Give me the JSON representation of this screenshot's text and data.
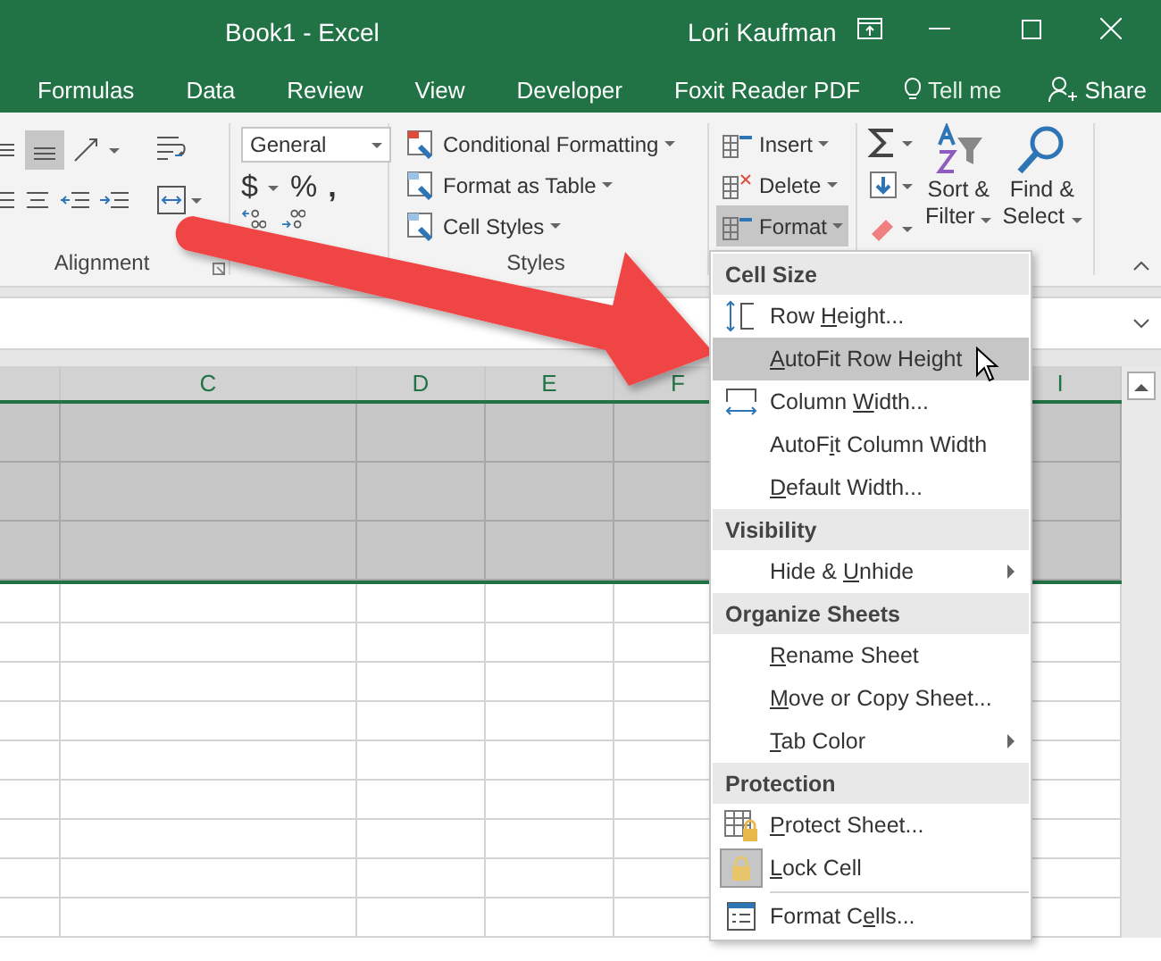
{
  "window": {
    "title": "Book1 - Excel",
    "user": "Lori Kaufman"
  },
  "ribbon_tabs": [
    "Formulas",
    "Data",
    "Review",
    "View",
    "Developer",
    "Foxit Reader PDF"
  ],
  "tell_me": "Tell me",
  "share": "Share",
  "ribbon": {
    "alignment_group": {
      "label": "Alignment"
    },
    "number_group": {
      "format": "General",
      "currency": "$",
      "percent": "%",
      "comma": ","
    },
    "styles_group": {
      "label": "Styles",
      "buttons": [
        "Conditional Formatting",
        "Format as Table",
        "Cell Styles"
      ]
    },
    "cells_group": {
      "buttons": [
        {
          "label": "Insert",
          "selected": false
        },
        {
          "label": "Delete",
          "selected": false
        },
        {
          "label": "Format",
          "selected": true
        }
      ]
    },
    "editing_group": {
      "buttons": [
        {
          "line1": "Sort &",
          "line2": "Filter"
        },
        {
          "line1": "Find &",
          "line2": "Select"
        }
      ]
    }
  },
  "sheet": {
    "column_headers": [
      "C",
      "D",
      "E",
      "F",
      "I"
    ],
    "rows": [
      {
        "selected": true
      },
      {
        "selected": true
      },
      {
        "selected": true
      },
      {
        "selected": false
      },
      {
        "selected": false
      },
      {
        "selected": false
      },
      {
        "selected": false
      },
      {
        "selected": false
      },
      {
        "selected": false
      },
      {
        "selected": false
      },
      {
        "selected": false
      },
      {
        "selected": false
      }
    ]
  },
  "menu": {
    "items": [
      {
        "kind": "header",
        "label": "Cell Size"
      },
      {
        "kind": "item",
        "before": "Row ",
        "key": "H",
        "after": "eight...",
        "selected": false,
        "checked": false,
        "submenu": false
      },
      {
        "kind": "item",
        "key": "A",
        "after": "utoFit Row Height",
        "selected": true,
        "checked": false,
        "submenu": false
      },
      {
        "kind": "item",
        "before": "Column ",
        "key": "W",
        "after": "idth...",
        "selected": false,
        "checked": false,
        "submenu": false
      },
      {
        "kind": "item",
        "before": "AutoF",
        "key": "i",
        "after": "t Column Width",
        "selected": false,
        "checked": false,
        "submenu": false
      },
      {
        "kind": "item",
        "key": "D",
        "after": "efault Width...",
        "selected": false,
        "checked": false,
        "submenu": false
      },
      {
        "kind": "header",
        "label": "Visibility"
      },
      {
        "kind": "item",
        "before": "Hide & ",
        "key": "U",
        "after": "nhide",
        "selected": false,
        "checked": false,
        "submenu": true
      },
      {
        "kind": "header",
        "label": "Organize Sheets"
      },
      {
        "kind": "item",
        "key": "R",
        "after": "ename Sheet",
        "selected": false,
        "checked": false,
        "submenu": false
      },
      {
        "kind": "item",
        "key": "M",
        "after": "ove or Copy Sheet...",
        "selected": false,
        "checked": false,
        "submenu": false
      },
      {
        "kind": "item",
        "key": "T",
        "after": "ab Color",
        "selected": false,
        "checked": false,
        "submenu": true
      },
      {
        "kind": "header",
        "label": "Protection"
      },
      {
        "kind": "item",
        "key": "P",
        "after": "rotect Sheet...",
        "selected": false,
        "checked": false,
        "submenu": false
      },
      {
        "kind": "item",
        "key": "L",
        "after": "ock Cell",
        "selected": false,
        "checked": true,
        "submenu": false
      },
      {
        "kind": "separator"
      },
      {
        "kind": "item",
        "before": "Format C",
        "key": "e",
        "after": "lls...",
        "selected": false,
        "checked": false,
        "submenu": false
      }
    ]
  }
}
